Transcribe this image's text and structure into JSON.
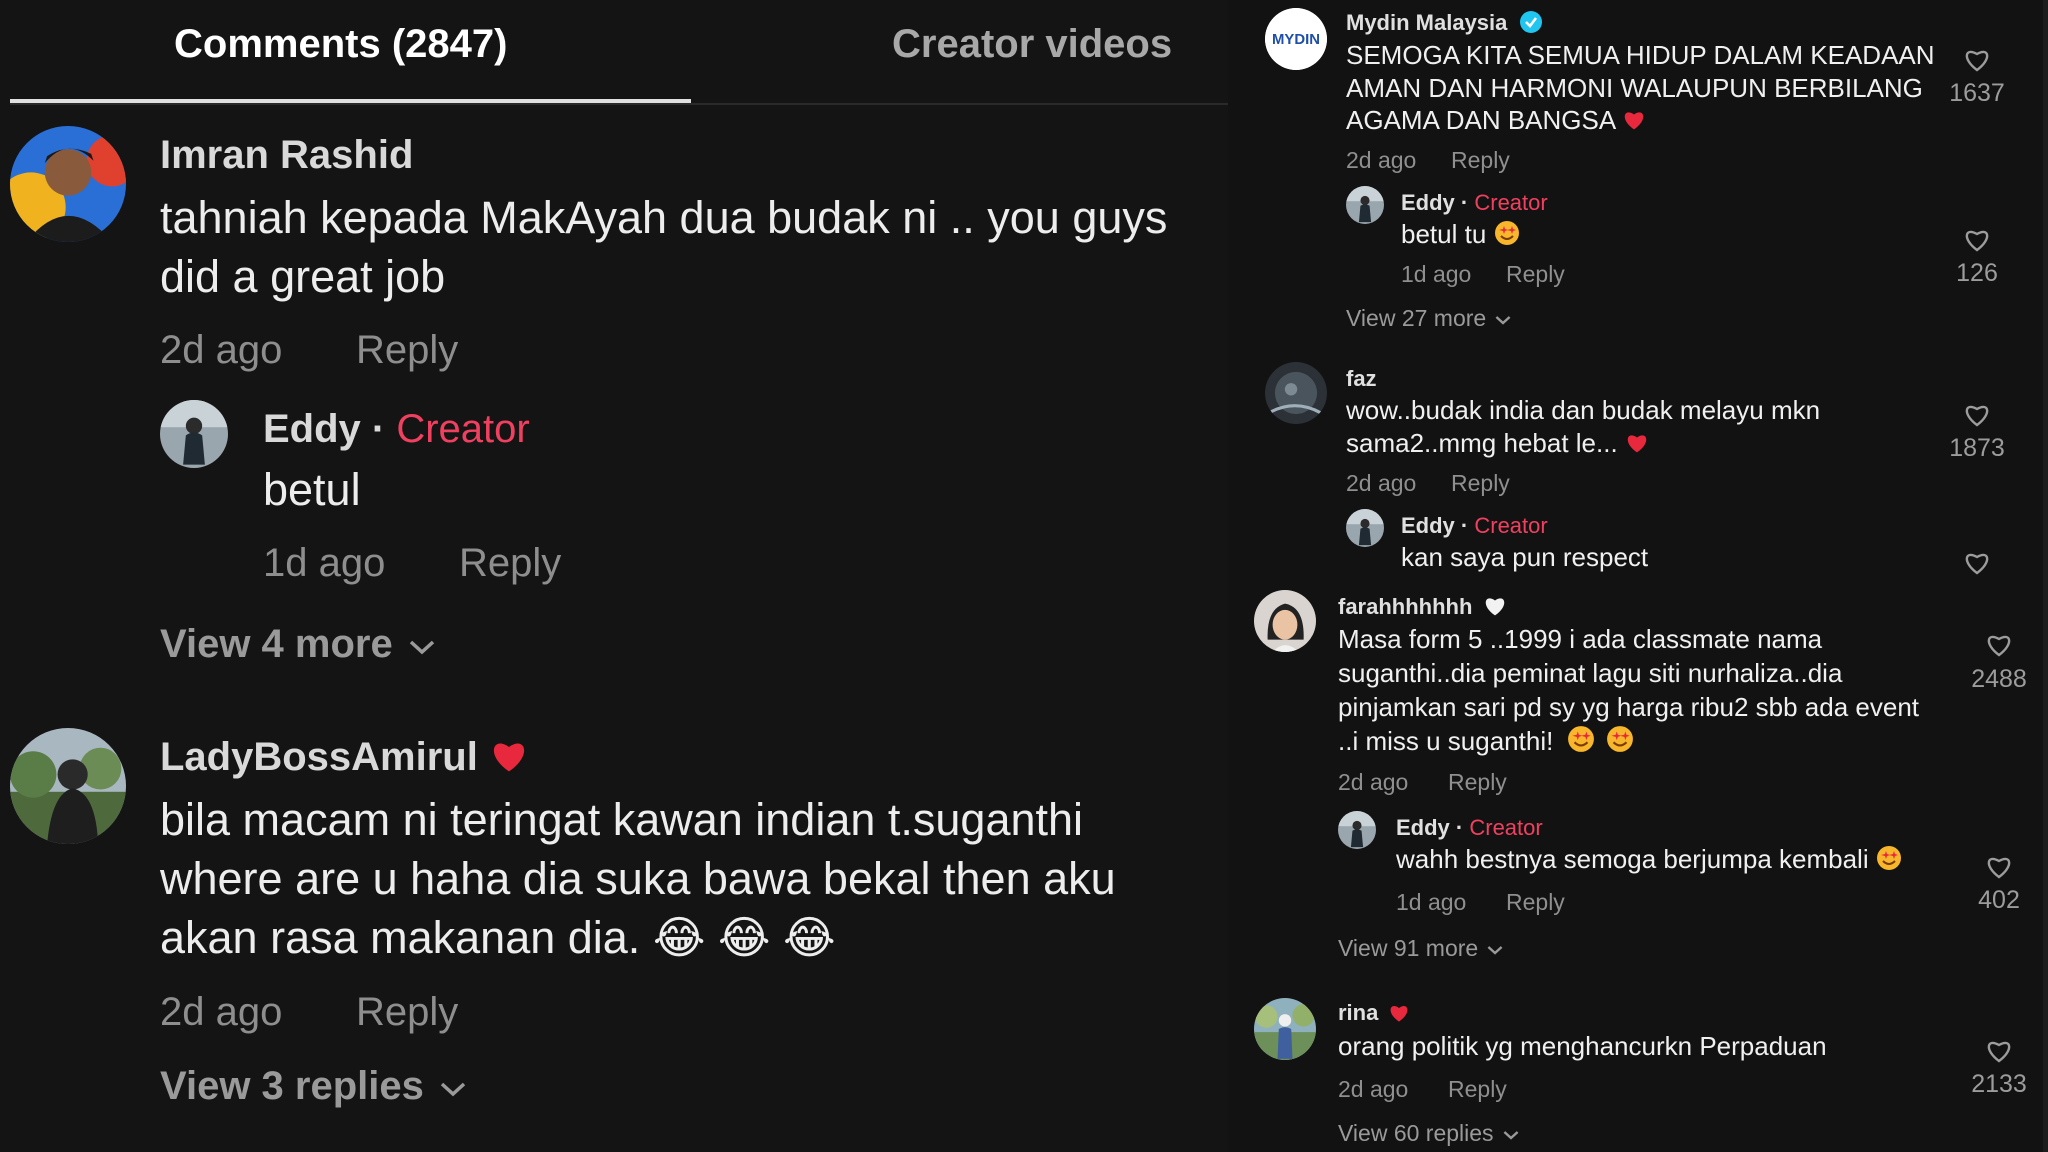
{
  "tabs": {
    "comments": "Comments (2847)",
    "creator_videos": "Creator videos"
  },
  "left": {
    "c1": {
      "name": "Imran Rashid",
      "line1": "tahniah kepada MakAyah dua budak ni .. you guys",
      "line2": "did a great job",
      "time": "2d ago",
      "reply": "Reply"
    },
    "c1r": {
      "name": "Eddy",
      "sep": " · ",
      "creator": "Creator",
      "text": "betul",
      "time": "1d ago",
      "reply": "Reply"
    },
    "c1_view": "View 4 more",
    "c2": {
      "name": "LadyBossAmirul",
      "line1": "bila macam ni teringat kawan indian t.suganthi",
      "line2": "where are u haha dia suka bawa bekal then aku",
      "line3": "akan rasa makanan dia.",
      "emojis": "😂 😂 😂",
      "time": "2d ago",
      "reply": "Reply"
    },
    "c2_view": "View 3 replies"
  },
  "right": {
    "m": {
      "name": "Mydin Malaysia",
      "logo_text": "MYDIN",
      "line1": "SEMOGA KITA SEMUA HIDUP DALAM KEADAAN",
      "line2": "AMAN DAN HARMONI WALAUPUN BERBILANG",
      "line3": "AGAMA DAN BANGSA",
      "time": "2d ago",
      "reply": "Reply",
      "likes": "1637"
    },
    "mr": {
      "name": "Eddy",
      "sep": " · ",
      "creator": "Creator",
      "text": "betul tu",
      "time": "1d ago",
      "reply": "Reply",
      "likes": "126"
    },
    "m_view": "View 27 more",
    "f": {
      "name": "faz",
      "line1": "wow..budak india dan budak melayu mkn",
      "line2": "sama2..mmg hebat le...",
      "time": "2d ago",
      "reply": "Reply",
      "likes": "1873"
    },
    "fr": {
      "name": "Eddy",
      "sep": " · ",
      "creator": "Creator",
      "text": "kan saya pun respect"
    },
    "fa": {
      "name": "farahhhhhhh",
      "line1": "Masa form 5 ..1999 i ada classmate nama",
      "line2": "suganthi..dia peminat lagu siti nurhaliza..dia",
      "line3": "pinjamkan sari pd sy yg harga ribu2 sbb ada event",
      "line4": "..i miss u suganthi!",
      "time": "2d ago",
      "reply": "Reply",
      "likes": "2488"
    },
    "far": {
      "name": "Eddy",
      "sep": " · ",
      "creator": "Creator",
      "text": "wahh bestnya semoga berjumpa kembali",
      "time": "1d ago",
      "reply": "Reply",
      "likes": "402"
    },
    "fa_view": "View 91 more",
    "r": {
      "name": "rina",
      "text": "orang politik yg menghancurkn Perpaduan",
      "time": "2d ago",
      "reply": "Reply",
      "likes": "2133"
    },
    "r_view": "View 60 replies"
  },
  "colors": {
    "creator": "#f0405f",
    "heart_red": "#e8283c",
    "verified": "#20c5f0"
  },
  "icons": [
    "heart-icon",
    "chevron-down-icon",
    "verified-badge-icon",
    "red-heart-emoji",
    "white-heart-emoji",
    "laughing-emoji",
    "star-struck-emoji"
  ]
}
